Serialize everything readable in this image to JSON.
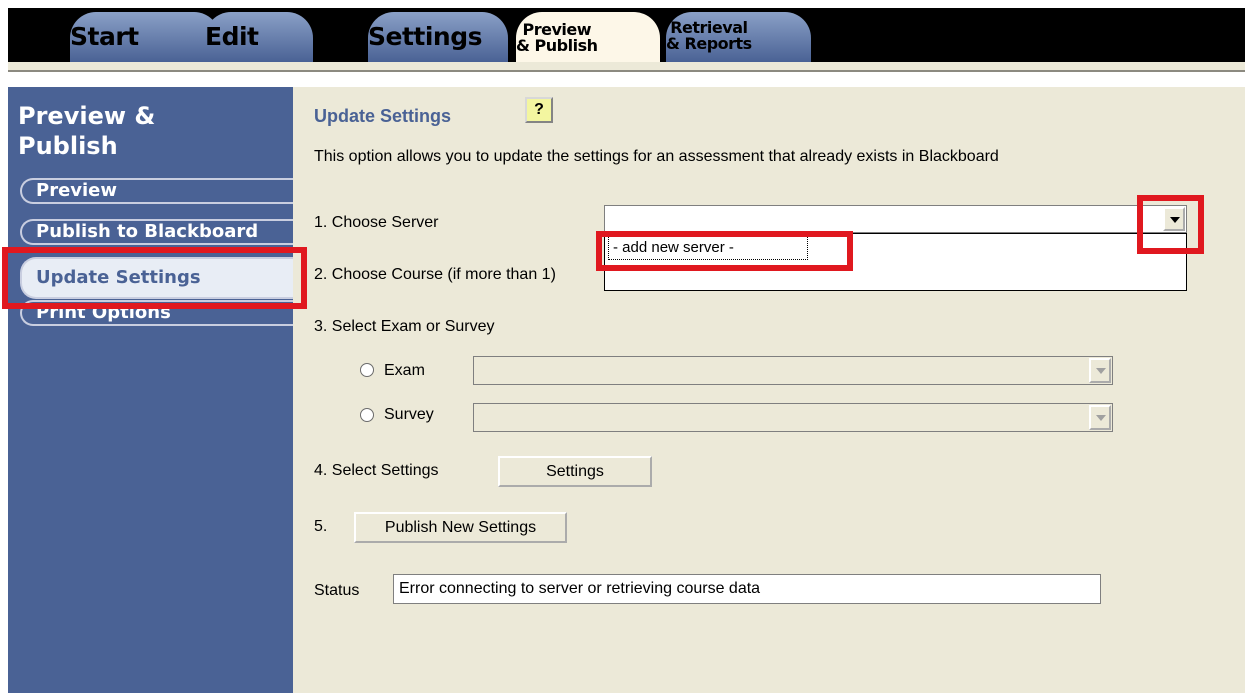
{
  "tabs": [
    {
      "label": "Start"
    },
    {
      "label": "Edit"
    },
    {
      "label": "Settings"
    },
    {
      "label_line1": "Preview",
      "label_line2": "& Publish"
    },
    {
      "label_line1": "Retrieval",
      "label_line2": "& Reports"
    }
  ],
  "sidebar": {
    "title_line1": "Preview &",
    "title_line2": "Publish",
    "items": [
      {
        "label": "Preview"
      },
      {
        "label": "Publish to Blackboard"
      },
      {
        "label": "Update Settings"
      },
      {
        "label": "Print Options"
      }
    ]
  },
  "main": {
    "heading": "Update Settings",
    "help_icon": "?",
    "description": "This option allows you to update the settings for an assessment that already exists in Blackboard",
    "step1_label": "1.  Choose Server",
    "server_value": "",
    "dropdown_option": "- add new server -",
    "step2_label": "2.  Choose Course (if more than 1)",
    "step3_label": "3.  Select Exam or Survey",
    "exam_label": "Exam",
    "survey_label": "Survey",
    "step4_label": "4.  Select Settings",
    "settings_button": "Settings",
    "step5_label": "5.",
    "publish_button": "Publish New Settings",
    "status_label": "Status",
    "status_value": "Error connecting to server or retrieving course data"
  },
  "colors": {
    "accent": "#4a6295",
    "active_tab_text": "#d5371f",
    "highlight": "#e0181f",
    "panel": "#ece9d8"
  }
}
